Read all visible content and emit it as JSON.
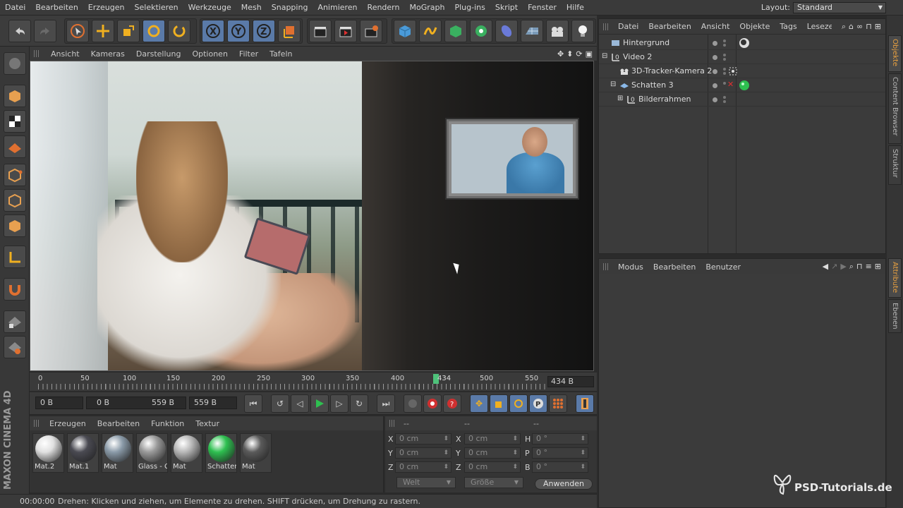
{
  "menubar": {
    "items": [
      "Datei",
      "Bearbeiten",
      "Erzeugen",
      "Selektieren",
      "Werkzeuge",
      "Mesh",
      "Snapping",
      "Animieren",
      "Rendern",
      "MoGraph",
      "Plug-ins",
      "Skript",
      "Fenster",
      "Hilfe"
    ],
    "layout_label": "Layout:",
    "layout_value": "Standard"
  },
  "viewport": {
    "menu": [
      "Ansicht",
      "Kameras",
      "Darstellung",
      "Optionen",
      "Filter",
      "Tafeln"
    ]
  },
  "timeline": {
    "ticks": [
      "0",
      "50",
      "100",
      "150",
      "200",
      "250",
      "300",
      "350",
      "400",
      "450",
      "500",
      "550"
    ],
    "current_frame_label": "434",
    "current_frame_fraction": 0.778,
    "frame_field": "434 B"
  },
  "playbar": {
    "start_field": "0 B",
    "range_start": "0 B",
    "range_end": "559 B",
    "end_field": "559 B"
  },
  "materials": {
    "menu": [
      "Erzeugen",
      "Bearbeiten",
      "Funktion",
      "Textur"
    ],
    "items": [
      {
        "label": "Mat.2",
        "color": "#e0e0e0"
      },
      {
        "label": "Mat.1",
        "color": "#4a4a52"
      },
      {
        "label": "Mat",
        "color": "#8a9aa8"
      },
      {
        "label": "Glass - C",
        "color": "#9a9a9a"
      },
      {
        "label": "Mat",
        "color": "#b8b8b8"
      },
      {
        "label": "Schatten",
        "color": "#2ec050"
      },
      {
        "label": "Mat",
        "color": "#5a5a5a"
      }
    ]
  },
  "coords": {
    "headers": [
      "--",
      "--",
      "--"
    ],
    "rows": [
      {
        "a": "X",
        "av": "0 cm",
        "b": "X",
        "bv": "0 cm",
        "c": "H",
        "cv": "0 °"
      },
      {
        "a": "Y",
        "av": "0 cm",
        "b": "Y",
        "bv": "0 cm",
        "c": "P",
        "cv": "0 °"
      },
      {
        "a": "Z",
        "av": "0 cm",
        "b": "Z",
        "bv": "0 cm",
        "c": "B",
        "cv": "0 °"
      }
    ],
    "mode_drop": "Welt",
    "size_drop": "Größe",
    "apply": "Anwenden"
  },
  "status": {
    "time": "00:00:00",
    "message": "Drehen: Klicken und ziehen, um Elemente zu drehen. SHIFT drücken, um Drehung zu rastern."
  },
  "brand": {
    "text": "MAXON CINEMA 4D"
  },
  "objects": {
    "menu": [
      "Datei",
      "Bearbeiten",
      "Ansicht",
      "Objekte",
      "Tags",
      "Lesezeichen"
    ],
    "rows": [
      {
        "name": "Hintergrund"
      },
      {
        "name": "Video 2"
      },
      {
        "name": "3D-Tracker-Kamera 2"
      },
      {
        "name": "Schatten 3"
      },
      {
        "name": "Bilderrahmen"
      }
    ]
  },
  "attributes": {
    "menu": [
      "Modus",
      "Bearbeiten",
      "Benutzer"
    ]
  },
  "sidetabs": [
    "Objekte",
    "Content Browser",
    "Struktur",
    "Attribute",
    "Ebenen"
  ],
  "watermark": {
    "text": "PSD-Tutorials.de"
  },
  "colors": {
    "accent": "#5a7aa8",
    "play_green": "#2ec050",
    "marker_green": "#4ec27a",
    "tab_active": "#e8a040"
  }
}
